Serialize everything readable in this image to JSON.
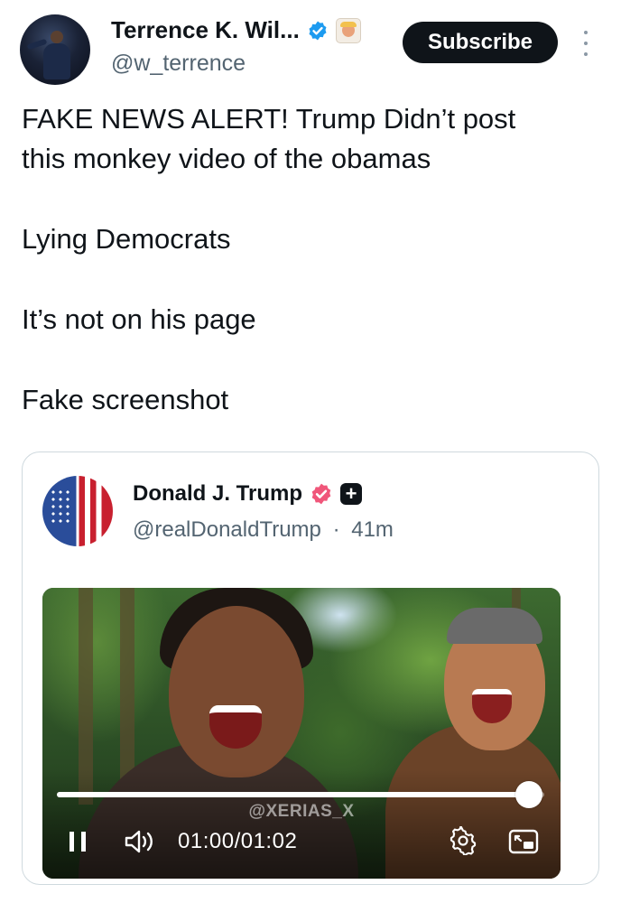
{
  "post": {
    "author_name": "Terrence K. Wil...",
    "author_handle": "@w_terrence",
    "subscribe_label": "Subscribe",
    "text_lines": [
      "FAKE NEWS ALERT! Trump Didn’t post",
      "this monkey video of the obamas",
      "Lying Democrats",
      "It’s not on his page",
      "Fake screenshot"
    ]
  },
  "quoted_post": {
    "author_name": "Donald J. Trump",
    "author_handle": "@realDonaldTrump",
    "separator": "·",
    "time_ago": "41m",
    "plus_glyph": "+"
  },
  "video": {
    "watermark": "@XERIAS_X",
    "current_time": "01:00",
    "total_time": "01:02",
    "time_separator": "/",
    "progress": 0.968
  },
  "icons": {
    "verified": "verified-badge-icon",
    "avatar_badge": "emoji-badge-icon",
    "more": "more-options-icon",
    "pause": "pause-icon",
    "volume": "volume-icon",
    "settings": "settings-gear-icon",
    "pip": "picture-in-picture-icon"
  },
  "colors": {
    "accent_blue": "#1d9bf0",
    "quoted_badge_pink": "#f0567a",
    "text_primary": "#0f1419",
    "text_secondary": "#536471"
  }
}
